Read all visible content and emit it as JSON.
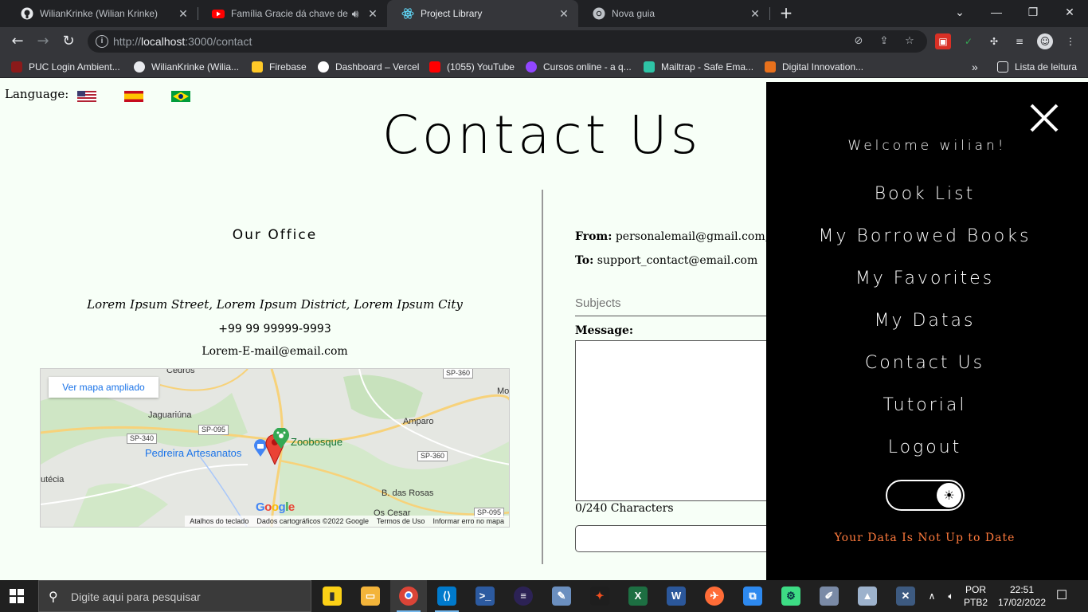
{
  "browser": {
    "tabs": [
      {
        "title": "WilianKrinke (Wilian Krinke)",
        "icon": "github-icon"
      },
      {
        "title": "Família Gracie dá chave de p",
        "icon": "youtube-icon"
      },
      {
        "title": "Project Library",
        "icon": "react-icon"
      },
      {
        "title": "Nova guia",
        "icon": "chrome-icon"
      }
    ],
    "url_prefix": "http://",
    "url_host": "localhost",
    "url_path": ":3000/contact",
    "bookmarks": [
      "PUC Login Ambient...",
      "WilianKrinke (Wilia...",
      "Firebase",
      "Dashboard – Vercel",
      "(1055) YouTube",
      "Cursos online - a q...",
      "Mailtrap - Safe Ema...",
      "Digital Innovation..."
    ],
    "reading_list": "Lista de leitura"
  },
  "page": {
    "language_label": "Language:",
    "title": "Contact Us",
    "office": {
      "heading": "Our Office",
      "address": "Lorem Ipsum Street, Lorem Ipsum District, Lorem Ipsum City",
      "phone": "+99 99 99999-9993",
      "email": "Lorem-E-mail@email.com"
    },
    "map": {
      "button": "Ver mapa ampliado",
      "labels": [
        "Jaguariúna",
        "Pedreira Artesanatos",
        "Zoobosque",
        "Amparo",
        "B. das Rosas",
        "utécia",
        "Os Cesar",
        "Mo",
        "Cedros"
      ],
      "roads": [
        "SP-360",
        "SP-340",
        "SP-095",
        "SP-360",
        "SP-095"
      ],
      "logo": "Google",
      "footer": [
        "Atalhos do teclado",
        "Dados cartográficos ©2022 Google",
        "Termos de Uso",
        "Informar erro no mapa"
      ]
    },
    "form": {
      "from_label": "From:",
      "from_value": "personalemail@gmail.com,",
      "to_label": "To:",
      "to_value": "support_contact@email.com",
      "subject_placeholder": "Subjects",
      "message_label": "Message:",
      "char_count": "0/240 Characters"
    }
  },
  "sidemenu": {
    "welcome": "Welcome wilian!",
    "items": [
      "Book List",
      "My Borrowed Books",
      "My Favorites",
      "My Datas",
      "Contact Us",
      "Tutorial",
      "Logout"
    ],
    "warning": "Your Data Is Not Up to Date",
    "theme_toggle_icon": "sun-icon"
  },
  "taskbar": {
    "search_placeholder": "Digite aqui para pesquisar",
    "lang": "POR",
    "layout": "PTB2",
    "time": "22:51",
    "date": "17/02/2022"
  }
}
